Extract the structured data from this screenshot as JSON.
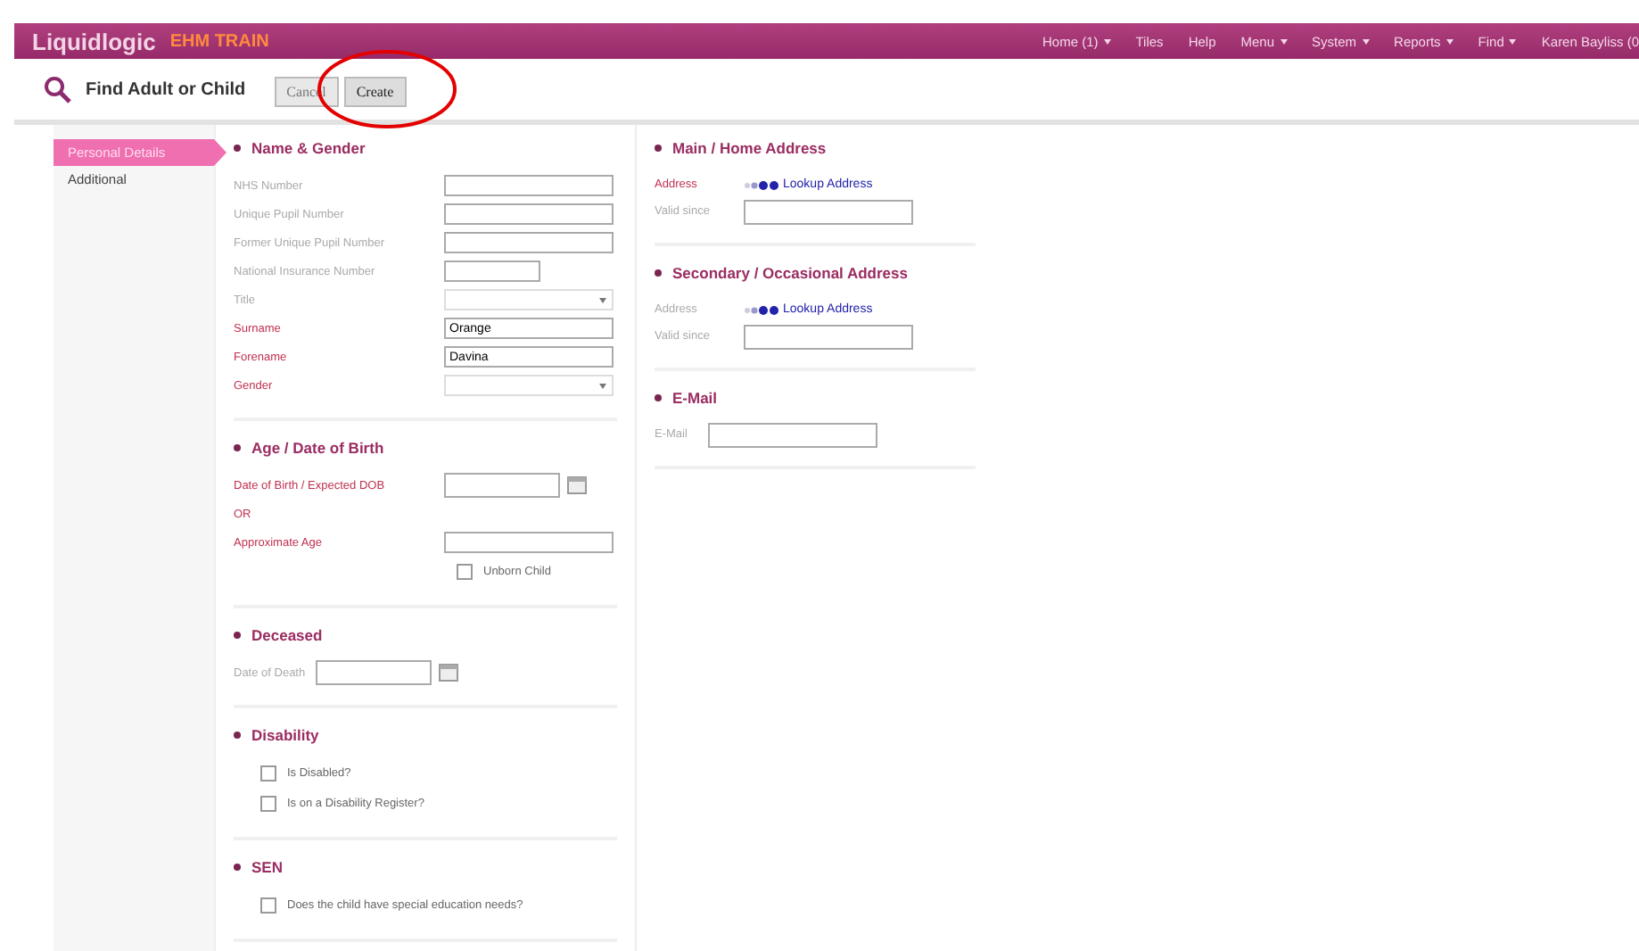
{
  "topbar": {
    "brand": "Liquidlogic",
    "environment": "EHM TRAIN",
    "menu": [
      {
        "label": "Home (1)",
        "dropdown": true
      },
      {
        "label": "Tiles",
        "dropdown": false
      },
      {
        "label": "Help",
        "dropdown": false
      },
      {
        "label": "Menu",
        "dropdown": true
      },
      {
        "label": "System",
        "dropdown": true
      },
      {
        "label": "Reports",
        "dropdown": true
      },
      {
        "label": "Find",
        "dropdown": true
      },
      {
        "label": "Karen Bayliss (0",
        "dropdown": false
      }
    ]
  },
  "toolbar": {
    "title": "Find Adult or Child",
    "buttons": [
      {
        "label": "Cancel",
        "highlighted": false
      },
      {
        "label": "Create",
        "highlighted": true
      }
    ]
  },
  "nav": [
    {
      "label": "Personal Details",
      "selected": true
    },
    {
      "label": "Additional",
      "selected": false
    }
  ],
  "sections": [
    {
      "title": "Name & Gender",
      "rows": [
        {
          "kind": "text",
          "label": "NHS Number",
          "required": false
        },
        {
          "kind": "text",
          "label": "Unique Pupil Number",
          "required": false
        },
        {
          "kind": "text",
          "label": "Former Unique Pupil Number",
          "required": false
        },
        {
          "kind": "short",
          "label": "National Insurance Number",
          "required": false
        },
        {
          "kind": "select",
          "label": "Title",
          "required": false
        },
        {
          "kind": "text",
          "label": "Surname",
          "required": true,
          "value": "Orange"
        },
        {
          "kind": "text",
          "label": "Forename",
          "required": true,
          "value": "Davina"
        },
        {
          "kind": "select",
          "label": "Gender",
          "required": true
        }
      ]
    },
    {
      "title": "Age / Date of Birth",
      "rows": [
        {
          "kind": "date",
          "label": "Date of Birth / Expected DOB",
          "required": true
        },
        {
          "kind": "note",
          "label": "OR",
          "required": true
        },
        {
          "kind": "text",
          "label": "Approximate Age",
          "required": true
        },
        {
          "kind": "aligned-checkbox",
          "label": "Unborn Child",
          "checked": false
        }
      ]
    },
    {
      "title": "Deceased",
      "rows": [
        {
          "kind": "inline-date",
          "label": "Date of Death",
          "required": false
        }
      ]
    },
    {
      "title": "Disability",
      "rows": [
        {
          "kind": "checkbox",
          "label": "Is Disabled?",
          "checked": false
        },
        {
          "kind": "checkbox",
          "label": "Is on a Disability Register?",
          "checked": false
        }
      ]
    },
    {
      "title": "SEN",
      "rows": [
        {
          "kind": "checkbox",
          "label": "Does the child have special education needs?",
          "checked": false
        }
      ]
    }
  ],
  "right_sections": [
    {
      "title": "Main / Home Address",
      "address_label": "Address",
      "required": true,
      "lookup": "Lookup Address",
      "valid_label": "Valid since"
    },
    {
      "title": "Secondary / Occasional Address",
      "address_label": "Address",
      "required": false,
      "lookup": "Lookup Address",
      "valid_label": "Valid since"
    },
    {
      "title": "E-Mail",
      "field_label": "E-Mail"
    }
  ]
}
